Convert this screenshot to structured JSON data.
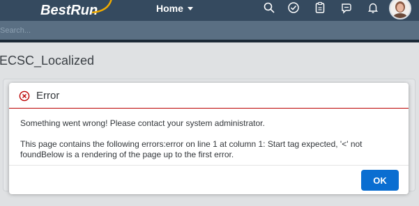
{
  "shell": {
    "logo_text": "BestRun",
    "home_label": "Home",
    "icons": [
      "search-icon",
      "checkmark-circle-icon",
      "clipboard-icon",
      "notes-icon",
      "bell-icon"
    ],
    "avatar": "user-avatar"
  },
  "subbar": {
    "text": "Search..."
  },
  "page": {
    "title": "ECSC_Localized"
  },
  "dialog": {
    "title": "Error",
    "message1": "Something went wrong! Please contact your system administrator.",
    "message2": "This page contains the following errors:error on line 1 at column 1: Start tag expected, '<' not foundBelow is a rendering of the page up to the first error.",
    "ok_label": "OK"
  },
  "colors": {
    "shell_bg": "#354a5f",
    "error_red": "#bb0000",
    "accent_blue": "#0a6ed1"
  }
}
